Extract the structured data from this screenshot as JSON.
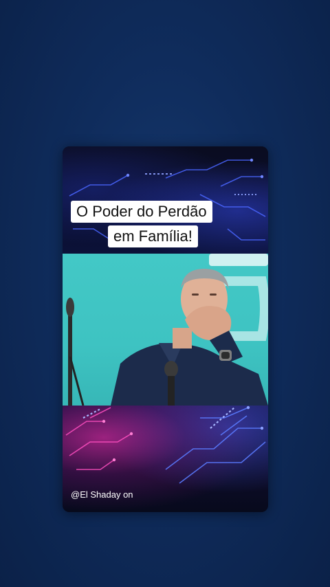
{
  "post": {
    "title_line1": "O Poder do Perdão",
    "title_line2": "em Família!",
    "handle": "@El Shaday on"
  },
  "icons": {
    "video": "speaker-on-stage-video",
    "background": "circuit-pattern"
  },
  "colors": {
    "page_background": "#0f2c5c",
    "video_backdrop": "#43c8c6",
    "caption_background": "#ffffff",
    "caption_text": "#101010",
    "accent_blue": "#3a5bff",
    "accent_magenta": "#d0309a"
  }
}
